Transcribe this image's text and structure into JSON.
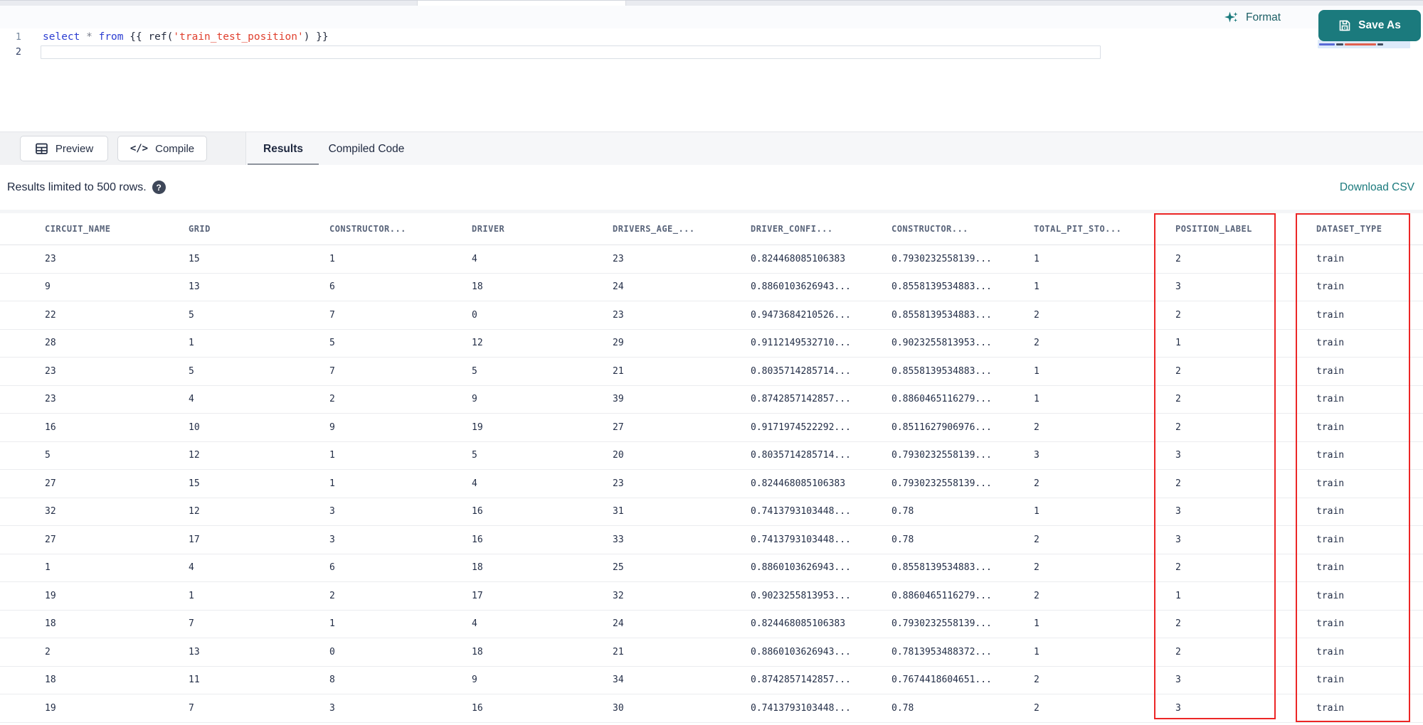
{
  "colors": {
    "accent_teal": "#1b7a7d",
    "highlight_red": "#ec2626",
    "keyword_blue": "#2c3ed2",
    "string_red": "#e0402e"
  },
  "toolbar": {
    "format_label": "Format",
    "save_as_label": "Save As"
  },
  "editor": {
    "lines": [
      {
        "number": "1",
        "tokens": [
          {
            "text": "select",
            "type": "keyword"
          },
          {
            "text": " ",
            "type": "plain"
          },
          {
            "text": "*",
            "type": "operator"
          },
          {
            "text": " ",
            "type": "plain"
          },
          {
            "text": "from",
            "type": "keyword"
          },
          {
            "text": " ",
            "type": "plain"
          },
          {
            "text": "{{",
            "type": "jinja"
          },
          {
            "text": " ",
            "type": "plain"
          },
          {
            "text": "ref(",
            "type": "jinja"
          },
          {
            "text": "'train_test_position'",
            "type": "string"
          },
          {
            "text": ")",
            "type": "jinja"
          },
          {
            "text": " ",
            "type": "plain"
          },
          {
            "text": "}}",
            "type": "jinja"
          }
        ]
      },
      {
        "number": "2",
        "tokens": []
      }
    ]
  },
  "action_bar": {
    "preview_label": "Preview",
    "compile_label": "Compile",
    "compile_icon_glyph": "</>",
    "tabs": [
      {
        "label": "Results",
        "active": true
      },
      {
        "label": "Compiled Code",
        "active": false
      }
    ]
  },
  "results_bar": {
    "limit_text": "Results limited to 500 rows.",
    "help_icon_glyph": "?",
    "download_label": "Download CSV"
  },
  "table": {
    "columns": [
      "CIRCUIT_NAME",
      "GRID",
      "CONSTRUCTOR...",
      "DRIVER",
      "DRIVERS_AGE_...",
      "DRIVER_CONFI...",
      "CONSTRUCTOR...",
      "TOTAL_PIT_STO...",
      "POSITION_LABEL",
      "DATASET_TYPE"
    ],
    "highlighted_columns": [
      "POSITION_LABEL",
      "DATASET_TYPE"
    ],
    "rows": [
      [
        "23",
        "15",
        "1",
        "4",
        "23",
        "0.824468085106383",
        "0.7930232558139...",
        "1",
        "2",
        "train"
      ],
      [
        "9",
        "13",
        "6",
        "18",
        "24",
        "0.8860103626943...",
        "0.8558139534883...",
        "1",
        "3",
        "train"
      ],
      [
        "22",
        "5",
        "7",
        "0",
        "23",
        "0.9473684210526...",
        "0.8558139534883...",
        "2",
        "2",
        "train"
      ],
      [
        "28",
        "1",
        "5",
        "12",
        "29",
        "0.9112149532710...",
        "0.9023255813953...",
        "2",
        "1",
        "train"
      ],
      [
        "23",
        "5",
        "7",
        "5",
        "21",
        "0.8035714285714...",
        "0.8558139534883...",
        "1",
        "2",
        "train"
      ],
      [
        "23",
        "4",
        "2",
        "9",
        "39",
        "0.8742857142857...",
        "0.8860465116279...",
        "1",
        "2",
        "train"
      ],
      [
        "16",
        "10",
        "9",
        "19",
        "27",
        "0.9171974522292...",
        "0.8511627906976...",
        "2",
        "2",
        "train"
      ],
      [
        "5",
        "12",
        "1",
        "5",
        "20",
        "0.8035714285714...",
        "0.7930232558139...",
        "3",
        "3",
        "train"
      ],
      [
        "27",
        "15",
        "1",
        "4",
        "23",
        "0.824468085106383",
        "0.7930232558139...",
        "2",
        "2",
        "train"
      ],
      [
        "32",
        "12",
        "3",
        "16",
        "31",
        "0.7413793103448...",
        "0.78",
        "1",
        "3",
        "train"
      ],
      [
        "27",
        "17",
        "3",
        "16",
        "33",
        "0.7413793103448...",
        "0.78",
        "2",
        "3",
        "train"
      ],
      [
        "1",
        "4",
        "6",
        "18",
        "25",
        "0.8860103626943...",
        "0.8558139534883...",
        "2",
        "2",
        "train"
      ],
      [
        "19",
        "1",
        "2",
        "17",
        "32",
        "0.9023255813953...",
        "0.8860465116279...",
        "2",
        "1",
        "train"
      ],
      [
        "18",
        "7",
        "1",
        "4",
        "24",
        "0.824468085106383",
        "0.7930232558139...",
        "1",
        "2",
        "train"
      ],
      [
        "2",
        "13",
        "0",
        "18",
        "21",
        "0.8860103626943...",
        "0.7813953488372...",
        "1",
        "2",
        "train"
      ],
      [
        "18",
        "11",
        "8",
        "9",
        "34",
        "0.8742857142857...",
        "0.7674418604651...",
        "2",
        "3",
        "train"
      ],
      [
        "19",
        "7",
        "3",
        "16",
        "30",
        "0.7413793103448...",
        "0.78",
        "2",
        "3",
        "train"
      ]
    ]
  }
}
